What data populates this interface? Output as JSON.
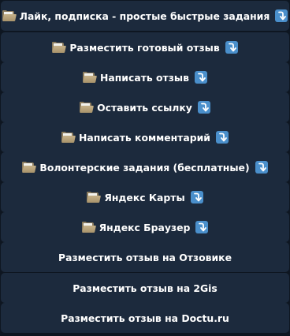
{
  "keyboard": {
    "buttons": [
      {
        "label": "Лайк, подписка - простые быстрые задания",
        "icon_left": "folder-icon",
        "icon_right": "arrow-down-icon"
      },
      {
        "label": "Разместить готовый отзыв",
        "icon_left": "folder-icon",
        "icon_right": "arrow-down-icon"
      },
      {
        "label": "Написать отзыв",
        "icon_left": "folder-icon",
        "icon_right": "arrow-down-icon"
      },
      {
        "label": "Оставить ссылку",
        "icon_left": "folder-icon",
        "icon_right": "arrow-down-icon"
      },
      {
        "label": "Написать комментарий",
        "icon_left": "folder-icon",
        "icon_right": "arrow-down-icon"
      },
      {
        "label": "Волонтерские задания (бесплатные)",
        "icon_left": "folder-icon",
        "icon_right": "arrow-down-icon"
      },
      {
        "label": "Яндекс Карты",
        "icon_left": "folder-icon",
        "icon_right": "arrow-down-icon"
      },
      {
        "label": "Яндекс Браузер",
        "icon_left": "folder-icon",
        "icon_right": "arrow-down-icon"
      },
      {
        "label": "Разместить отзыв на Отзовике"
      },
      {
        "label": "Разместить отзыв на 2Gis"
      },
      {
        "label": "Разместить отзыв на Doctu.ru"
      }
    ]
  },
  "colors": {
    "background": "#0e1621",
    "button": "#1c2a3d",
    "text": "#ffffff",
    "arrow_icon_bg": "#4a8fcb"
  }
}
